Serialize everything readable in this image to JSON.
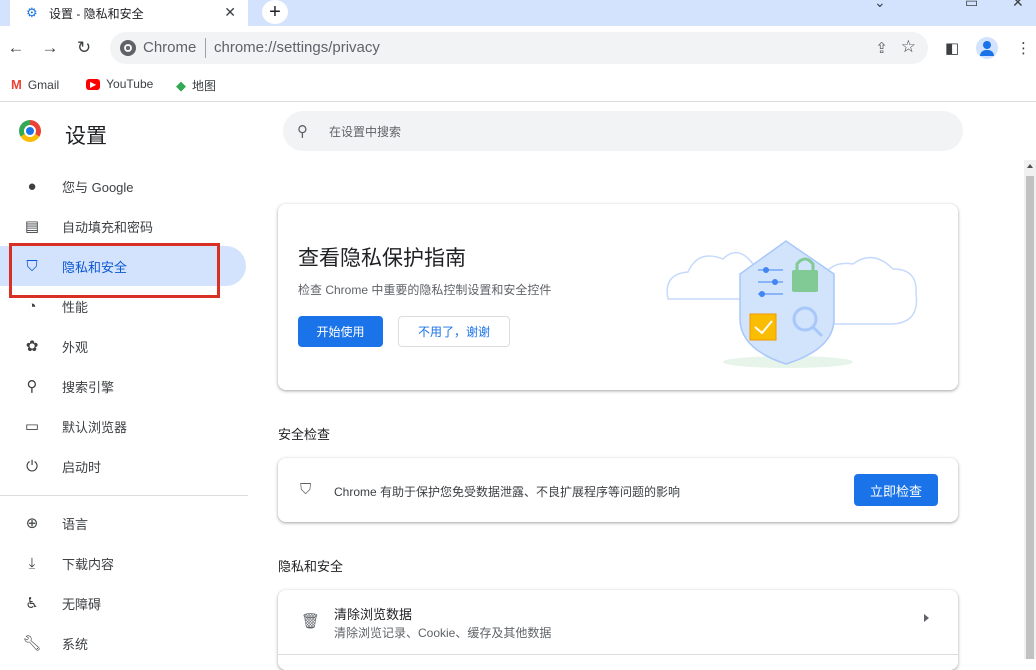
{
  "tab": {
    "title": "设置 - 隐私和安全",
    "close": "✕"
  },
  "toolbar": {
    "site_chip": "Chrome",
    "url": "chrome://settings/privacy"
  },
  "bookmarks": [
    {
      "label": "Gmail",
      "icon": "gmail-icon",
      "glyph": "M",
      "color": "#ea4335"
    },
    {
      "label": "YouTube",
      "icon": "youtube-icon",
      "glyph": "▶",
      "color": "#ff0000"
    },
    {
      "label": "地图",
      "icon": "maps-icon",
      "glyph": "◆",
      "color": "#34a853"
    }
  ],
  "sidebar": {
    "title": "设置",
    "items": [
      {
        "label": "您与 Google",
        "icon": "person-icon"
      },
      {
        "label": "自动填充和密码",
        "icon": "clipboard-icon"
      },
      {
        "label": "隐私和安全",
        "icon": "shield-icon",
        "active": true
      },
      {
        "label": "性能",
        "icon": "speedometer-icon"
      },
      {
        "label": "外观",
        "icon": "palette-icon"
      },
      {
        "label": "搜索引擎",
        "icon": "search-icon"
      },
      {
        "label": "默认浏览器",
        "icon": "browser-icon"
      },
      {
        "label": "启动时",
        "icon": "power-icon"
      },
      {
        "label": "语言",
        "icon": "globe-icon"
      },
      {
        "label": "下载内容",
        "icon": "download-icon"
      },
      {
        "label": "无障碍",
        "icon": "accessibility-icon"
      },
      {
        "label": "系统",
        "icon": "wrench-icon"
      }
    ]
  },
  "search": {
    "placeholder": "在设置中搜索"
  },
  "guide": {
    "title": "查看隐私保护指南",
    "subtitle": "检查 Chrome 中重要的隐私控制设置和安全控件",
    "start_label": "开始使用",
    "dismiss_label": "不用了，谢谢"
  },
  "safety_check": {
    "section_title": "安全检查",
    "text": "Chrome 有助于保护您免受数据泄露、不良扩展程序等问题的影响",
    "button_label": "立即检查"
  },
  "privacy": {
    "section_title": "隐私和安全",
    "rows": [
      {
        "title": "清除浏览数据",
        "subtitle": "清除浏览记录、Cookie、缓存及其他数据",
        "icon": "trash-icon"
      }
    ]
  },
  "colors": {
    "accent": "#1a73e8",
    "active_bg": "#d3e3fd",
    "highlight": "#d93025"
  }
}
